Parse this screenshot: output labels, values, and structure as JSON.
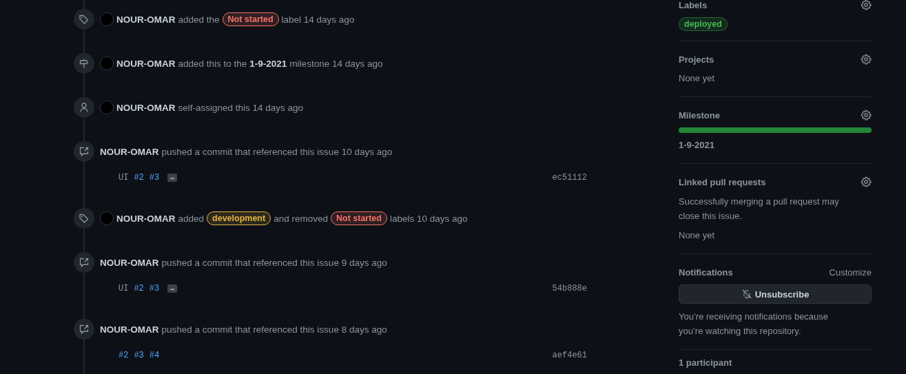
{
  "timeline": [
    {
      "kind": "label",
      "avatar": true,
      "actor": "NOUR-OMAR",
      "parts": [
        {
          "kind": "text",
          "text": "added the"
        },
        {
          "kind": "label",
          "text": "Not started",
          "color": "#f47067"
        },
        {
          "kind": "text",
          "text": "label 14 days ago"
        }
      ]
    },
    {
      "kind": "milestone",
      "avatar": true,
      "actor": "NOUR-OMAR",
      "parts": [
        {
          "kind": "text",
          "text": "added this to the"
        },
        {
          "kind": "bold",
          "text": "1-9-2021"
        },
        {
          "kind": "text",
          "text": "milestone 14 days ago"
        }
      ]
    },
    {
      "kind": "assigned",
      "avatar": true,
      "actor": "NOUR-OMAR",
      "parts": [
        {
          "kind": "text",
          "text": "self-assigned this 14 days ago"
        }
      ]
    },
    {
      "kind": "commit",
      "avatar": false,
      "actor": "NOUR-OMAR",
      "parts": [
        {
          "kind": "text",
          "text": "pushed a commit that referenced this issue 10 days ago"
        }
      ],
      "commit": {
        "message": [
          {
            "kind": "text",
            "text": "UI"
          },
          {
            "kind": "ref",
            "text": "#2"
          },
          {
            "kind": "ref",
            "text": "#3"
          }
        ],
        "expander": "…",
        "sha": "ec51112"
      }
    },
    {
      "kind": "label",
      "avatar": true,
      "actor": "NOUR-OMAR",
      "parts": [
        {
          "kind": "text",
          "text": "added"
        },
        {
          "kind": "label",
          "text": "development",
          "color": "#e3b341"
        },
        {
          "kind": "text",
          "text": "and removed"
        },
        {
          "kind": "label",
          "text": "Not started",
          "color": "#f47067"
        },
        {
          "kind": "text",
          "text": "labels 10 days ago"
        }
      ]
    },
    {
      "kind": "commit",
      "avatar": false,
      "actor": "NOUR-OMAR",
      "parts": [
        {
          "kind": "text",
          "text": "pushed a commit that referenced this issue 9 days ago"
        }
      ],
      "commit": {
        "message": [
          {
            "kind": "text",
            "text": "UI"
          },
          {
            "kind": "ref",
            "text": "#2"
          },
          {
            "kind": "ref",
            "text": "#3"
          }
        ],
        "expander": "…",
        "sha": "54b888e"
      }
    },
    {
      "kind": "commit",
      "avatar": false,
      "actor": "NOUR-OMAR",
      "parts": [
        {
          "kind": "text",
          "text": "pushed a commit that referenced this issue 8 days ago"
        }
      ],
      "commit": {
        "message": [
          {
            "kind": "ref",
            "text": "#2"
          },
          {
            "kind": "ref",
            "text": "#3"
          },
          {
            "kind": "ref",
            "text": "#4"
          }
        ],
        "sha": "aef4e61"
      }
    }
  ],
  "sidebar": {
    "labels": {
      "title": "Labels",
      "items": [
        {
          "text": "deployed",
          "color": "#3fb950"
        }
      ]
    },
    "projects": {
      "title": "Projects",
      "value": "None yet"
    },
    "milestone": {
      "title": "Milestone",
      "level": 1,
      "name": "1-9-2021"
    },
    "linked_pull_requests": {
      "title": "Linked pull requests",
      "note": "Successfully merging a pull request may close this issue.",
      "value": "None yet"
    },
    "notifications": {
      "title": "Notifications",
      "customize": "Customize",
      "button": "Unsubscribe",
      "note": "You’re receiving notifications because you’re watching this repository."
    },
    "participants": {
      "title": "1 participant"
    }
  }
}
